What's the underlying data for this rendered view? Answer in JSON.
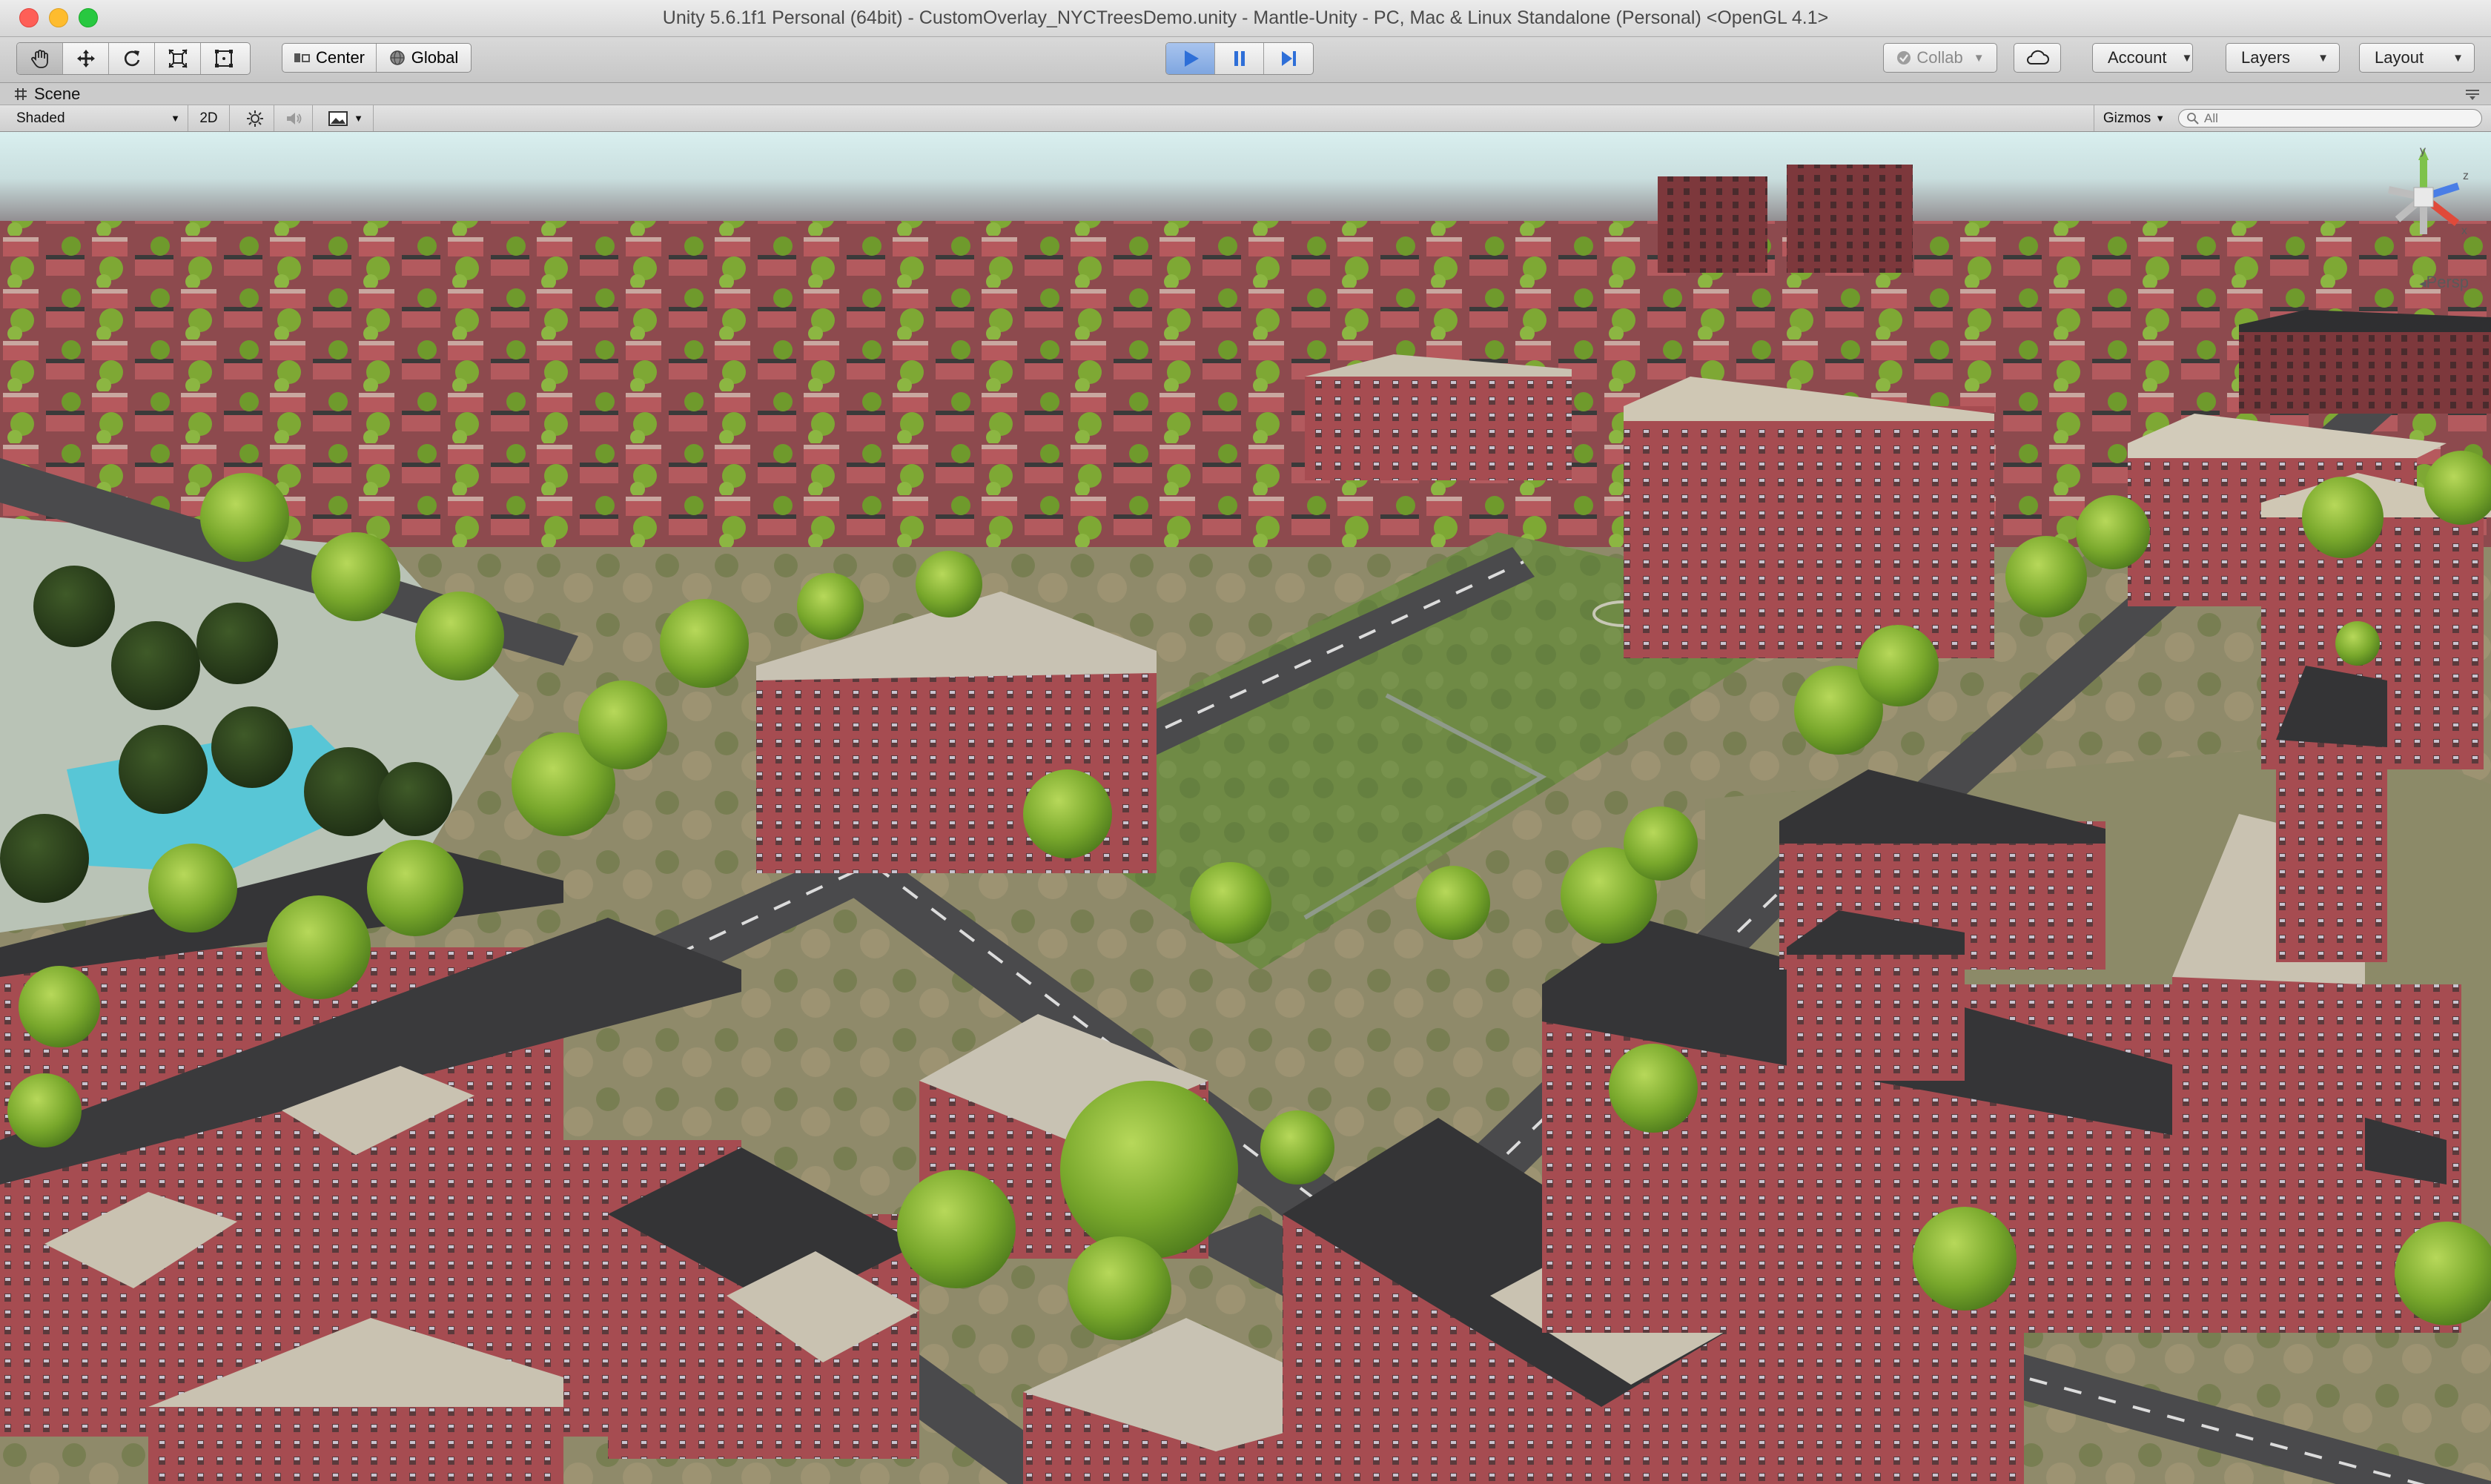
{
  "window": {
    "title": "Unity 5.6.1f1 Personal (64bit) - CustomOverlay_NYCTreesDemo.unity - Mantle-Unity - PC, Mac & Linux Standalone (Personal) <OpenGL 4.1>"
  },
  "toolbar": {
    "tools": [
      "hand-icon",
      "move-icon",
      "rotate-icon",
      "scale-icon",
      "rect-tool-icon"
    ],
    "pivot_mode": "Center",
    "pivot_rotation": "Global",
    "play_controls": [
      "play-icon",
      "pause-icon",
      "step-icon"
    ],
    "collab": "Collab",
    "account": "Account",
    "layers": "Layers",
    "layout": "Layout"
  },
  "scene_tab": {
    "label": "Scene"
  },
  "scene_options": {
    "draw_mode": "Shaded",
    "toggle_2d": "2D",
    "gizmos": "Gizmos",
    "search_placeholder": "All"
  },
  "viewport": {
    "projection": "Persp",
    "gizmo_axes": [
      "y",
      "z",
      "x"
    ]
  },
  "colors": {
    "play_accent": "#2e6fd8",
    "brick": "#a34a4f",
    "grass": "#6f8a45",
    "road": "#4a4a4c",
    "tree": "#79a82c"
  }
}
